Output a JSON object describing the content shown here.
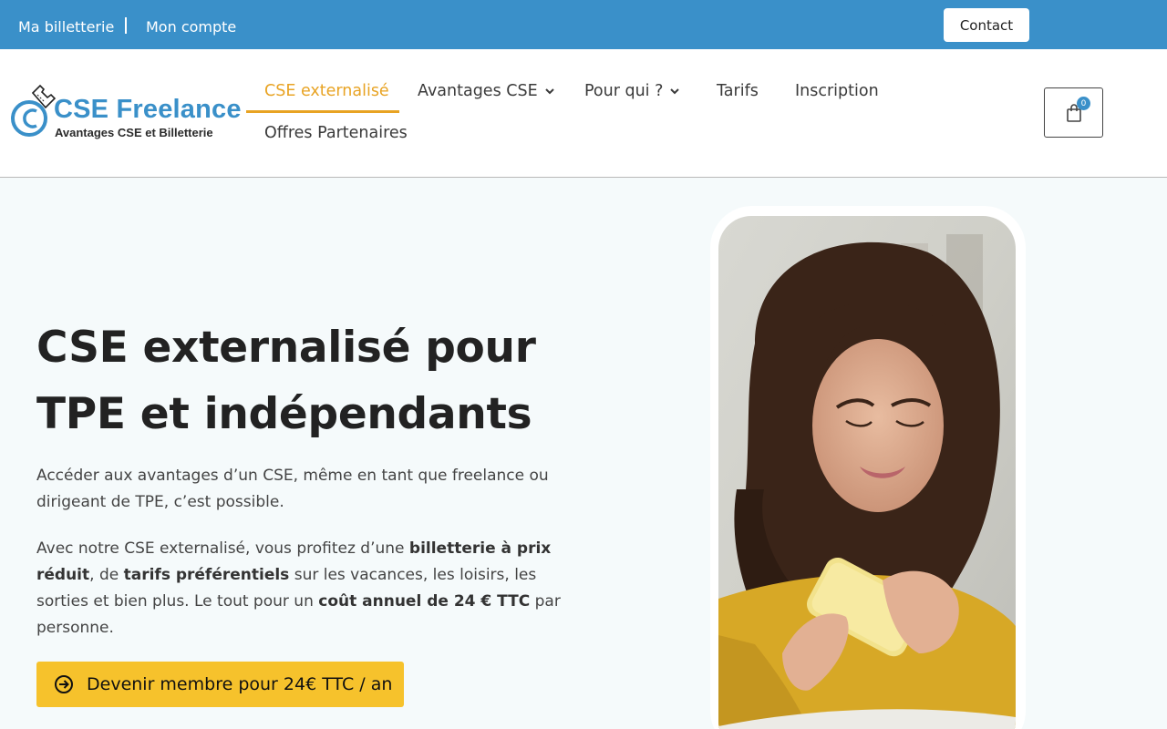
{
  "topbar": {
    "links": [
      "Ma billetterie",
      "Mon compte"
    ],
    "contact_label": "Contact"
  },
  "logo": {
    "title": "CSE Freelance",
    "subtitle": "Avantages CSE et Billetterie"
  },
  "nav": {
    "items": [
      {
        "label": "CSE externalisé",
        "active": true,
        "dropdown": false
      },
      {
        "label": "Avantages CSE",
        "active": false,
        "dropdown": true
      },
      {
        "label": "Pour qui ?",
        "active": false,
        "dropdown": true
      },
      {
        "label": "Tarifs",
        "active": false,
        "dropdown": false
      },
      {
        "label": "Inscription",
        "active": false,
        "dropdown": false
      },
      {
        "label": "Offres Partenaires",
        "active": false,
        "dropdown": false
      }
    ],
    "cart_count": "0"
  },
  "hero": {
    "title_line1": "CSE externalisé pour",
    "title_line2": "TPE et indépendants",
    "para1": "Accéder aux avantages d’un CSE, même en tant que freelance ou dirigeant de TPE, c’est possible.",
    "para2": {
      "t1": "Avec notre CSE externalisé, vous profitez d’une ",
      "b1": "billetterie à prix réduit",
      "t2": ", de ",
      "b2": "tarifs préférentiels",
      "t3": " sur les vacances, les loisirs, les sorties et bien plus. Le tout pour un ",
      "b3": "coût annuel de 24 € TTC",
      "t4": " par personne."
    },
    "cta_label": "Devenir membre pour 24€ TTC / an"
  },
  "colors": {
    "brand_blue": "#3a90c9",
    "accent_orange": "#e8a323",
    "cta_yellow": "#f6c22c"
  },
  "icons": [
    "ticket-c-logo-icon",
    "chevron-down-icon",
    "shopping-bag-icon",
    "arrow-circle-right-icon"
  ]
}
